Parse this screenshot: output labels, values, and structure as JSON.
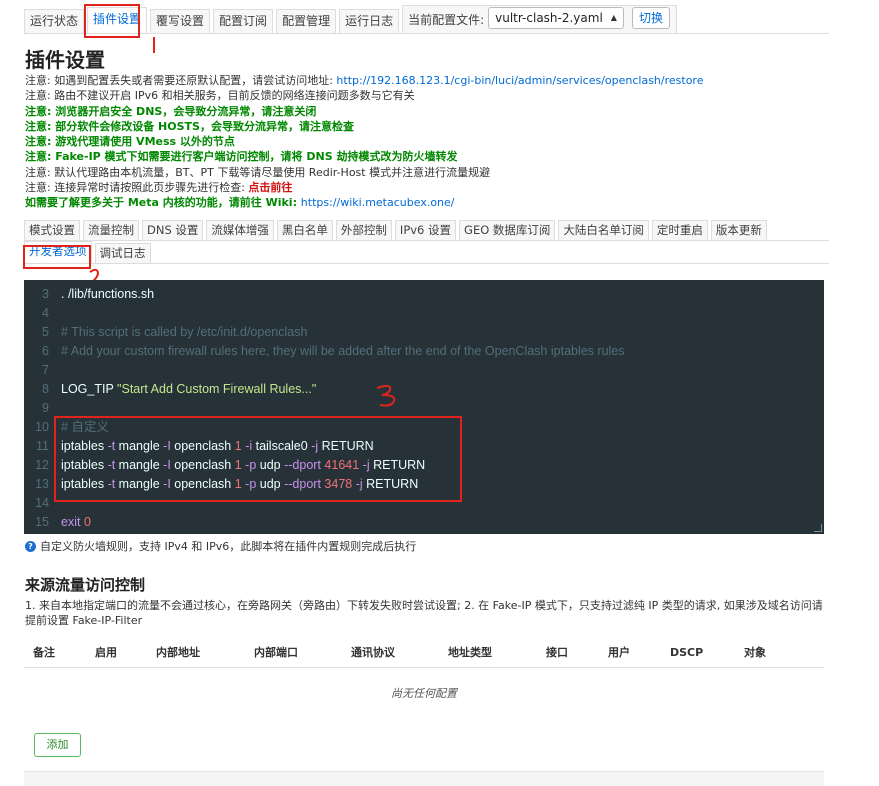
{
  "top_tabs": [
    {
      "label": "运行状态"
    },
    {
      "label": "插件设置"
    },
    {
      "label": "覆写设置"
    },
    {
      "label": "配置订阅"
    },
    {
      "label": "配置管理"
    },
    {
      "label": "运行日志"
    }
  ],
  "config_selector": {
    "label": "当前配置文件:",
    "value": "vultr-clash-2.yaml",
    "switch_label": "切换"
  },
  "page_title": "插件设置",
  "notices": {
    "n1_prefix": "注意: 如遇到配置丢失或者需要还原默认配置，请尝试访问地址: ",
    "n1_link": "http://192.168.123.1/cgi-bin/luci/admin/services/openclash/restore",
    "n2": "注意: 路由不建议开启 IPv6 和相关服务，目前反馈的网络连接问题多数与它有关",
    "n3": "注意: 浏览器开启安全 DNS，会导致分流异常，请注意关闭",
    "n4": "注意: 部分软件会修改设备 HOSTS，会导致分流异常，请注意检查",
    "n5": "注意: 游戏代理请使用 VMess 以外的节点",
    "n6": "注意: Fake-IP 模式下如需要进行客户端访问控制，请将 DNS 劫持模式改为防火墙转发",
    "n7": "注意: 默认代理路由本机流量，BT、PT 下载等请尽量使用 Redir-Host 模式并注意进行流量规避",
    "n8_prefix": "注意: 连接异常时请按照此页步骤先进行检查: ",
    "n8_link": "点击前往",
    "n9_prefix": "如需要了解更多关于 Meta 内核的功能，请前往 Wiki: ",
    "n9_link": "https://wiki.metacubex.one/"
  },
  "sub_tabs_row1": [
    {
      "label": "模式设置"
    },
    {
      "label": "流量控制"
    },
    {
      "label": "DNS 设置"
    },
    {
      "label": "流媒体增强"
    },
    {
      "label": "黑白名单"
    },
    {
      "label": "外部控制"
    },
    {
      "label": "IPv6 设置"
    },
    {
      "label": "GEO 数据库订阅"
    },
    {
      "label": "大陆白名单订阅"
    },
    {
      "label": "定时重启"
    },
    {
      "label": "版本更新"
    }
  ],
  "sub_tabs_row2": [
    {
      "label": "开发者选项"
    },
    {
      "label": "调试日志"
    }
  ],
  "editor": {
    "lines": [
      {
        "n": "3",
        "parts": [
          {
            "t": ". /lib/functions.sh",
            "c": "code"
          }
        ]
      },
      {
        "n": "4",
        "parts": []
      },
      {
        "n": "5",
        "parts": [
          {
            "t": "# This script is called by /etc/init.d/openclash",
            "c": "cmt"
          }
        ]
      },
      {
        "n": "6",
        "parts": [
          {
            "t": "# Add your custom firewall rules here, they will be added after the end of the OpenClash iptables rules",
            "c": "cmt"
          }
        ]
      },
      {
        "n": "7",
        "parts": []
      },
      {
        "n": "8",
        "parts": [
          {
            "t": "LOG_TIP ",
            "c": "code"
          },
          {
            "t": "\"Start Add Custom Firewall Rules...\"",
            "c": "str"
          }
        ]
      },
      {
        "n": "9",
        "parts": []
      },
      {
        "n": "10",
        "parts": [
          {
            "t": "# 自定义",
            "c": "cmt"
          }
        ]
      },
      {
        "n": "11",
        "parts": [
          {
            "t": "iptables ",
            "c": "code"
          },
          {
            "t": "-t",
            "c": "kw"
          },
          {
            "t": " mangle ",
            "c": "code"
          },
          {
            "t": "-I",
            "c": "kw"
          },
          {
            "t": " openclash ",
            "c": "code"
          },
          {
            "t": "1",
            "c": "num"
          },
          {
            "t": " ",
            "c": "code"
          },
          {
            "t": "-i",
            "c": "kw"
          },
          {
            "t": " tailscale0 ",
            "c": "code"
          },
          {
            "t": "-j",
            "c": "kw"
          },
          {
            "t": " RETURN",
            "c": "code"
          }
        ]
      },
      {
        "n": "12",
        "parts": [
          {
            "t": "iptables ",
            "c": "code"
          },
          {
            "t": "-t",
            "c": "kw"
          },
          {
            "t": " mangle ",
            "c": "code"
          },
          {
            "t": "-I",
            "c": "kw"
          },
          {
            "t": " openclash ",
            "c": "code"
          },
          {
            "t": "1",
            "c": "num"
          },
          {
            "t": " ",
            "c": "code"
          },
          {
            "t": "-p",
            "c": "kw"
          },
          {
            "t": " udp ",
            "c": "code"
          },
          {
            "t": "--dport",
            "c": "kw"
          },
          {
            "t": " ",
            "c": "code"
          },
          {
            "t": "41641",
            "c": "num"
          },
          {
            "t": " ",
            "c": "code"
          },
          {
            "t": "-j",
            "c": "kw"
          },
          {
            "t": " RETURN",
            "c": "code"
          }
        ]
      },
      {
        "n": "13",
        "parts": [
          {
            "t": "iptables ",
            "c": "code"
          },
          {
            "t": "-t",
            "c": "kw"
          },
          {
            "t": " mangle ",
            "c": "code"
          },
          {
            "t": "-I",
            "c": "kw"
          },
          {
            "t": " openclash ",
            "c": "code"
          },
          {
            "t": "1",
            "c": "num"
          },
          {
            "t": " ",
            "c": "code"
          },
          {
            "t": "-p",
            "c": "kw"
          },
          {
            "t": " udp ",
            "c": "code"
          },
          {
            "t": "--dport",
            "c": "kw"
          },
          {
            "t": " ",
            "c": "code"
          },
          {
            "t": "3478",
            "c": "num"
          },
          {
            "t": " ",
            "c": "code"
          },
          {
            "t": "-j",
            "c": "kw"
          },
          {
            "t": " RETURN",
            "c": "code"
          }
        ]
      },
      {
        "n": "14",
        "parts": []
      },
      {
        "n": "15",
        "parts": [
          {
            "t": "exit",
            "c": "kw"
          },
          {
            "t": " ",
            "c": "code"
          },
          {
            "t": "0",
            "c": "num"
          }
        ]
      }
    ]
  },
  "help_text": "自定义防火墙规则，支持 IPv4 和 IPv6，此脚本将在插件内置规则完成后执行",
  "section": {
    "title": "来源流量访问控制",
    "desc": "1. 来自本地指定端口的流量不会通过核心，在旁路网关（旁路由）下转发失败时尝试设置; 2. 在 Fake-IP 模式下，只支持过滤纯 IP 类型的请求, 如果涉及域名访问请提前设置 Fake-IP-Filter"
  },
  "table": {
    "headers": [
      "备注",
      "启用",
      "内部地址",
      "内部端口",
      "通讯协议",
      "地址类型",
      "接口",
      "用户",
      "DSCP",
      "对象"
    ],
    "empty_text": "尚无任何配置"
  },
  "add_button": "添加"
}
